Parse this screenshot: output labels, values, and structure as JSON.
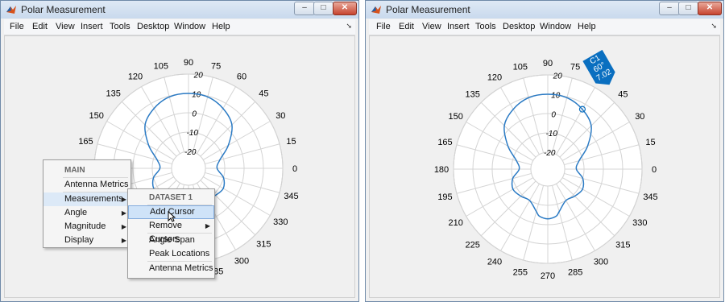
{
  "windows": [
    {
      "title": "Polar Measurement",
      "menus": [
        "File",
        "Edit",
        "View",
        "Insert",
        "Tools",
        "Desktop",
        "Window",
        "Help"
      ],
      "controls": {
        "minimize": "–",
        "maximize": "□",
        "close": "✕"
      }
    },
    {
      "title": "Polar Measurement",
      "menus": [
        "File",
        "Edit",
        "View",
        "Insert",
        "Tools",
        "Desktop",
        "Window",
        "Help"
      ],
      "controls": {
        "minimize": "–",
        "maximize": "□",
        "close": "✕"
      }
    }
  ],
  "polar": {
    "angle_labels": [
      "0",
      "15",
      "30",
      "45",
      "60",
      "75",
      "90",
      "105",
      "120",
      "135",
      "150",
      "165",
      "180",
      "195",
      "210",
      "225",
      "240",
      "255",
      "270",
      "285",
      "300",
      "315",
      "330",
      "345"
    ],
    "magnitude_labels": [
      "-20",
      "-10",
      "0",
      "10",
      "20"
    ],
    "trace_color": "#2a7ac4",
    "grid_color": "#d4d4d4"
  },
  "chart_data": {
    "type": "polar-line",
    "angle_ticks_deg": [
      0,
      15,
      30,
      45,
      60,
      75,
      90,
      105,
      120,
      135,
      150,
      165,
      180,
      195,
      210,
      225,
      240,
      255,
      270,
      285,
      300,
      315,
      330,
      345
    ],
    "radial_ticks": [
      -20,
      -10,
      0,
      10,
      20
    ],
    "rlim": [
      -20,
      20
    ],
    "series": [
      {
        "angles_deg": [
          0,
          15,
          30,
          45,
          60,
          75,
          90,
          105,
          120,
          135,
          150,
          165,
          180,
          195,
          210,
          225,
          240,
          255,
          260,
          270,
          280,
          285,
          300,
          315,
          330,
          345
        ],
        "values": [
          -14,
          -12,
          -5,
          3,
          7,
          9.5,
          10,
          9.5,
          7,
          3,
          -5,
          -12,
          -14,
          -10,
          -8,
          -9,
          -10,
          -6,
          -4,
          -3,
          -4,
          -6,
          -10,
          -9,
          -8,
          -10
        ]
      }
    ]
  },
  "left_menu": {
    "header": "MAIN",
    "items": [
      "Antenna Metrics",
      "Measurements",
      "Angle",
      "Magnitude",
      "Display"
    ]
  },
  "dataset_menu": {
    "header": "DATASET 1",
    "items": [
      "Add Cursor",
      "Remove Cursors",
      "Angle Span",
      "Peak Locations",
      "Antenna Metrics"
    ]
  },
  "cursor": {
    "label": "C1",
    "angle": "60°",
    "value": "7.02",
    "color": "#0a6fc0"
  }
}
